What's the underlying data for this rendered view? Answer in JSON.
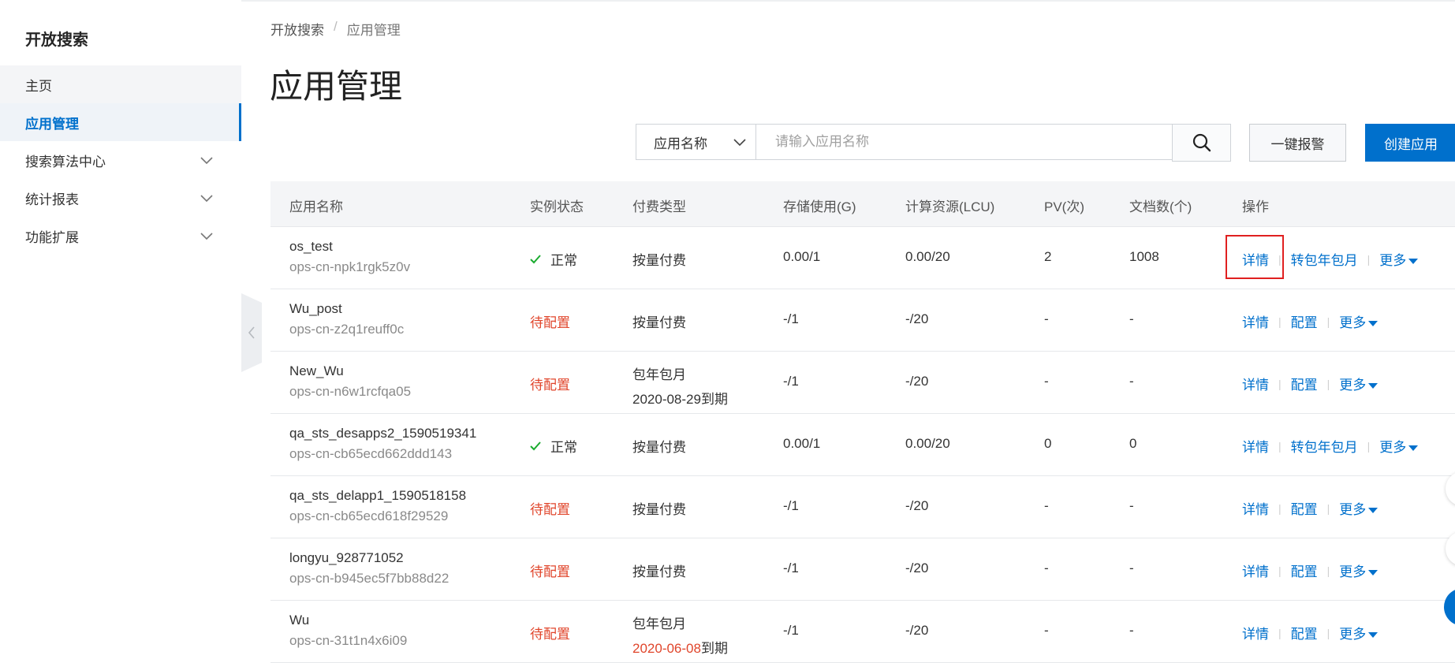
{
  "sidebar": {
    "title": "开放搜索",
    "items": [
      {
        "label": "主页"
      },
      {
        "label": "应用管理"
      },
      {
        "label": "搜索算法中心"
      },
      {
        "label": "统计报表"
      },
      {
        "label": "功能扩展"
      }
    ]
  },
  "breadcrumb": {
    "root": "开放搜索",
    "separator": "/",
    "current": "应用管理"
  },
  "page_title": "应用管理",
  "toolbar": {
    "filter_selected": "应用名称",
    "search_placeholder": "请输入应用名称",
    "alarm_label": "一键报警",
    "create_label": "创建应用"
  },
  "table": {
    "headers": [
      "应用名称",
      "实例状态",
      "付费类型",
      "存储使用(G)",
      "计算资源(LCU)",
      "PV(次)",
      "文档数(个)",
      "操作"
    ],
    "rows": [
      {
        "name": "os_test",
        "id": "ops-cn-npk1rgk5z0v",
        "status": "正常",
        "pay1": "按量付费",
        "pay2": "",
        "pay2_highlight": "",
        "pay2_suffix": "",
        "storage": "0.00/1",
        "cpu": "0.00/20",
        "pv": "2",
        "docs": "1008",
        "op1": "详情",
        "op2": "转包年包月",
        "op3": "更多"
      },
      {
        "name": "Wu_post",
        "id": "ops-cn-z2q1reuff0c",
        "status": "待配置",
        "pay1": "按量付费",
        "pay2": "",
        "pay2_highlight": "",
        "pay2_suffix": "",
        "storage": "-/1",
        "cpu": "-/20",
        "pv": "-",
        "docs": "-",
        "op1": "详情",
        "op2": "配置",
        "op3": "更多"
      },
      {
        "name": "New_Wu",
        "id": "ops-cn-n6w1rcfqa05",
        "status": "待配置",
        "pay1": "包年包月",
        "pay2": "2020-08-29到期",
        "pay2_highlight": "",
        "pay2_suffix": "",
        "storage": "-/1",
        "cpu": "-/20",
        "pv": "-",
        "docs": "-",
        "op1": "详情",
        "op2": "配置",
        "op3": "更多"
      },
      {
        "name": "qa_sts_desapps2_1590519341",
        "id": "ops-cn-cb65ecd662ddd143",
        "status": "正常",
        "pay1": "按量付费",
        "pay2": "",
        "pay2_highlight": "",
        "pay2_suffix": "",
        "storage": "0.00/1",
        "cpu": "0.00/20",
        "pv": "0",
        "docs": "0",
        "op1": "详情",
        "op2": "转包年包月",
        "op3": "更多"
      },
      {
        "name": "qa_sts_delapp1_1590518158",
        "id": "ops-cn-cb65ecd618f29529",
        "status": "待配置",
        "pay1": "按量付费",
        "pay2": "",
        "pay2_highlight": "",
        "pay2_suffix": "",
        "storage": "-/1",
        "cpu": "-/20",
        "pv": "-",
        "docs": "-",
        "op1": "详情",
        "op2": "配置",
        "op3": "更多"
      },
      {
        "name": "longyu_928771052",
        "id": "ops-cn-b945ec5f7bb88d22",
        "status": "待配置",
        "pay1": "按量付费",
        "pay2": "",
        "pay2_highlight": "",
        "pay2_suffix": "",
        "storage": "-/1",
        "cpu": "-/20",
        "pv": "-",
        "docs": "-",
        "op1": "详情",
        "op2": "配置",
        "op3": "更多"
      },
      {
        "name": "Wu",
        "id": "ops-cn-31t1n4x6i09",
        "status": "待配置",
        "pay1": "包年包月",
        "pay2": "",
        "pay2_highlight": "2020-06-08",
        "pay2_suffix": "到期",
        "storage": "-/1",
        "cpu": "-/20",
        "pv": "-",
        "docs": "-",
        "op1": "详情",
        "op2": "配置",
        "op3": "更多"
      }
    ]
  },
  "colors": {
    "accent": "#0070cc",
    "pending": "#e0452b",
    "ok": "#1aab2f",
    "highlight_box": "#e02020"
  }
}
